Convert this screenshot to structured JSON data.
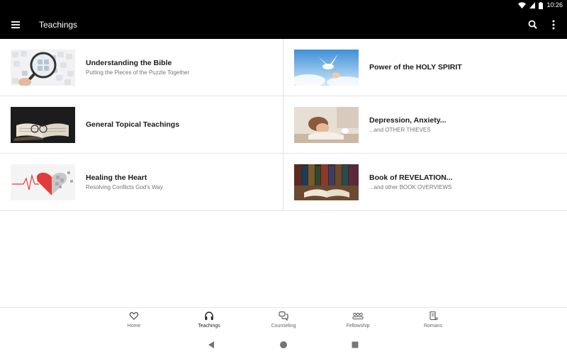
{
  "status_bar": {
    "time": "10:26",
    "icons": [
      "wifi-icon",
      "cell-signal-icon",
      "battery-icon"
    ]
  },
  "app_bar": {
    "title": "Teachings",
    "icons": [
      "menu-icon",
      "search-icon",
      "more-vert-icon"
    ]
  },
  "items": [
    {
      "title": "Understanding the Bible",
      "subtitle": "Putting the Pieces of the Puzzle Together",
      "image": "puzzle-magnifier-thumbnail"
    },
    {
      "title": "Power of the HOLY SPIRIT",
      "subtitle": "",
      "image": "dove-sky-thumbnail"
    },
    {
      "title": "General Topical Teachings",
      "subtitle": "",
      "image": "open-bible-glasses-thumbnail"
    },
    {
      "title": "Depression, Anxiety...",
      "subtitle": "...and OTHER THIEVES",
      "image": "sad-woman-thumbnail"
    },
    {
      "title": "Healing the Heart",
      "subtitle": "Resolving Conflicts God's Way",
      "image": "puzzle-heart-thumbnail"
    },
    {
      "title": "Book of REVELATION...",
      "subtitle": "...and other BOOK OVERVIEWS",
      "image": "library-books-thumbnail"
    }
  ],
  "bottom_nav": {
    "active": "Teachings",
    "items": [
      {
        "label": "Home",
        "icon": "heart-icon"
      },
      {
        "label": "Teachings",
        "icon": "headphones-icon"
      },
      {
        "label": "Counseling",
        "icon": "chat-bubbles-icon"
      },
      {
        "label": "Fellowship",
        "icon": "group-icon"
      },
      {
        "label": "Romans",
        "icon": "scroll-icon"
      }
    ]
  },
  "system_nav": {
    "icons": [
      "back-icon",
      "home-icon",
      "recents-icon"
    ]
  },
  "colors": {
    "app_bar_bg": "#000000",
    "divider": "#e3e3e3",
    "title_text": "#1a1a1a",
    "subtitle_text": "#757575",
    "nav_label": "#666666",
    "heart_red": "#e23b3b"
  }
}
